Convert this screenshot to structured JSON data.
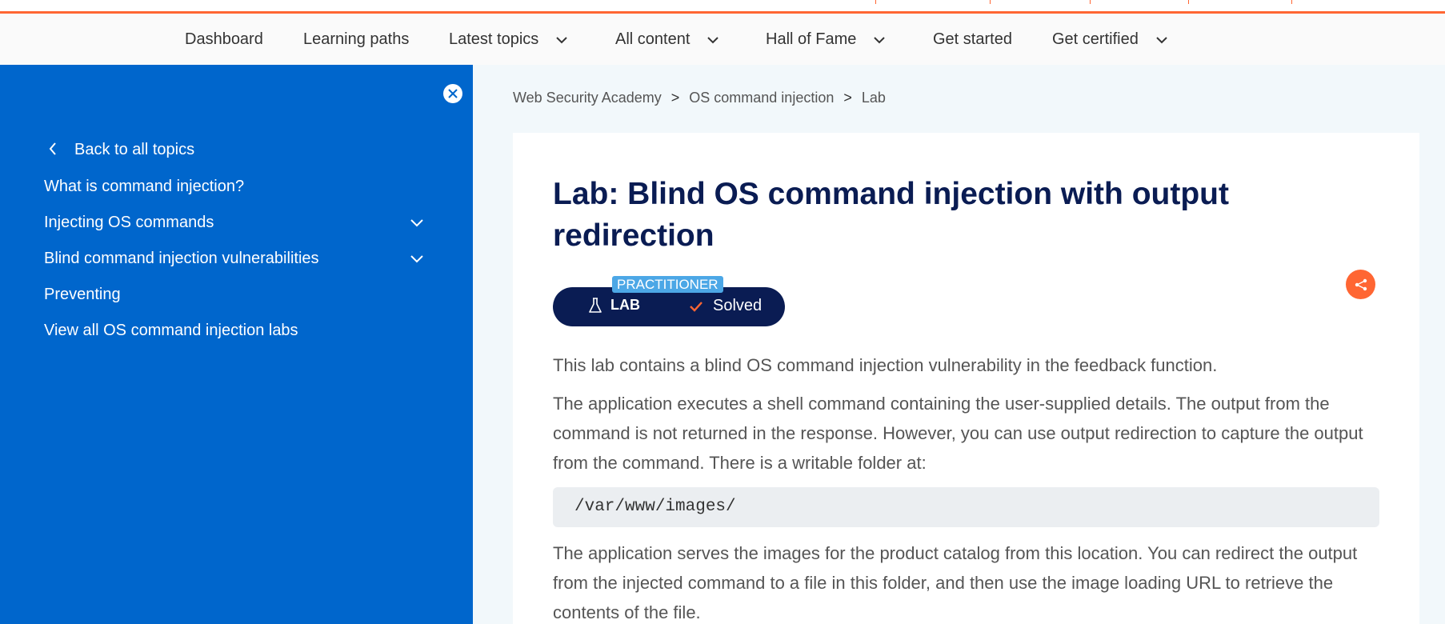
{
  "nav": {
    "items": [
      {
        "label": "Dashboard",
        "dropdown": false
      },
      {
        "label": "Learning paths",
        "dropdown": false
      },
      {
        "label": "Latest topics",
        "dropdown": true
      },
      {
        "label": "All content",
        "dropdown": true
      },
      {
        "label": "Hall of Fame",
        "dropdown": true
      },
      {
        "label": "Get started",
        "dropdown": false
      },
      {
        "label": "Get certified",
        "dropdown": true
      }
    ]
  },
  "sidebar": {
    "back_label": "Back to all topics",
    "items": [
      {
        "label": "What is command injection?",
        "expandable": false
      },
      {
        "label": "Injecting OS commands",
        "expandable": true
      },
      {
        "label": "Blind command injection vulnerabilities",
        "expandable": true
      },
      {
        "label": "Preventing",
        "expandable": false
      },
      {
        "label": "View all OS command injection labs",
        "expandable": false
      }
    ]
  },
  "breadcrumb": {
    "items": [
      "Web Security Academy",
      "OS command injection",
      "Lab"
    ],
    "separator": ">"
  },
  "lab": {
    "title": "Lab: Blind OS command injection with output redirection",
    "level": "PRACTITIONER",
    "badge_label": "LAB",
    "status": "Solved",
    "paragraphs": [
      "This lab contains a blind OS command injection vulnerability in the feedback function.",
      "The application executes a shell command containing the user-supplied details. The output from the command is not returned in the response. However, you can use output redirection to capture the output from the command. There is a writable folder at:",
      "The application serves the images for the product catalog from this location. You can redirect the output from the injected command to a file in this folder, and then use the image loading URL to retrieve the contents of the file."
    ],
    "code": "/var/www/images/"
  },
  "colors": {
    "accent": "#ff6633",
    "sidebar_bg": "#0066cc",
    "title_navy": "#0a1c53",
    "level_blue": "#4ca7e6"
  },
  "icons": {
    "close": "close-icon",
    "back": "chevron-left-icon",
    "expand": "chevron-down-icon",
    "flask": "flask-icon",
    "check": "checkmark-icon",
    "share": "share-icon"
  }
}
